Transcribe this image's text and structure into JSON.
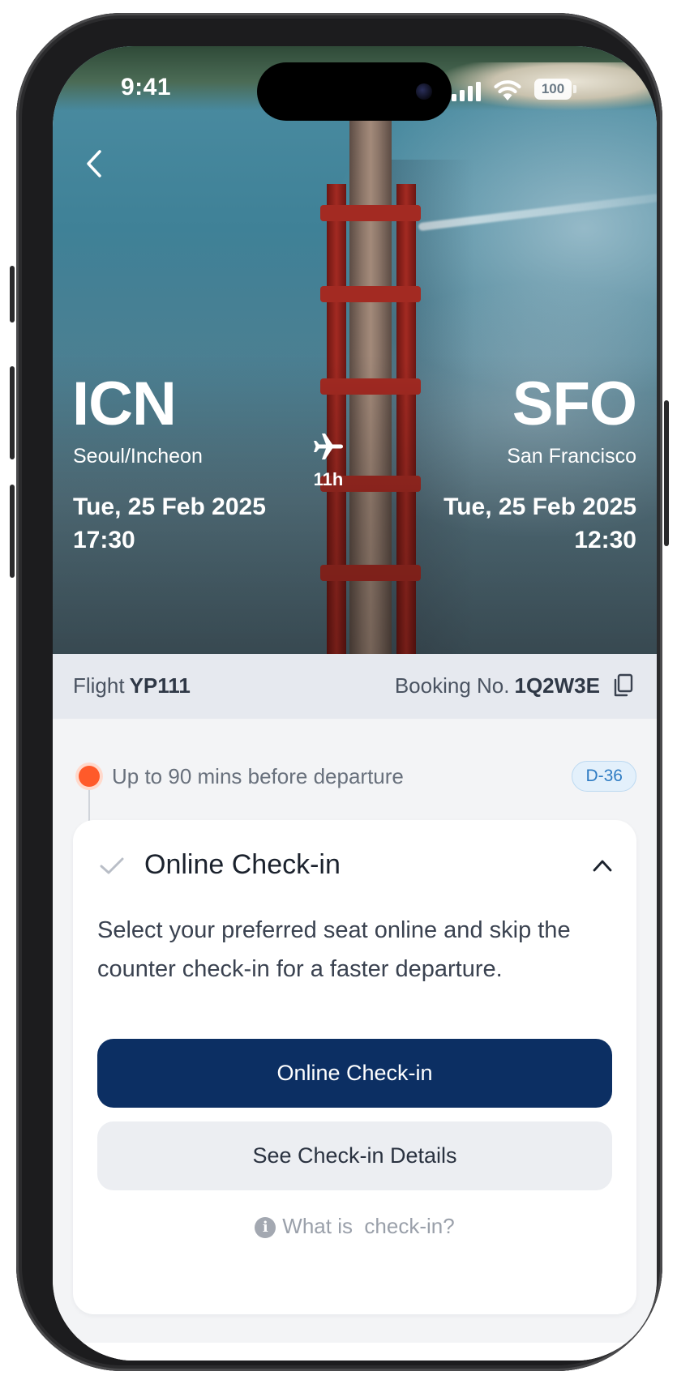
{
  "status_bar": {
    "time": "9:41",
    "battery": "100"
  },
  "route": {
    "origin": {
      "code": "ICN",
      "city": "Seoul/Incheon",
      "date": "Tue, 25 Feb 2025",
      "time": "17:30"
    },
    "destination": {
      "code": "SFO",
      "city": "San Francisco",
      "date": "Tue, 25 Feb 2025",
      "time": "12:30"
    },
    "duration": "11h"
  },
  "flight_bar": {
    "flight_label": "Flight",
    "flight_number": "YP111",
    "booking_label": "Booking No.",
    "booking_number": "1Q2W3E"
  },
  "timeline": {
    "step_text": "Up to 90 mins before departure",
    "badge": "D-36",
    "accent_color": "#ff5a2a"
  },
  "checkin_card": {
    "title": "Online Check-in",
    "description": "Select your preferred seat online and skip the counter check-in for a faster departure.",
    "primary_button": "Online Check-in",
    "secondary_button": "See Check-in Details",
    "help_link": "What is  check-in?",
    "primary_color": "#0c2f63"
  },
  "icons": [
    "back-icon",
    "signal-icon",
    "wifi-icon",
    "battery-icon",
    "airplane-icon",
    "copy-icon",
    "check-icon",
    "chevron-up-icon",
    "info-icon"
  ]
}
